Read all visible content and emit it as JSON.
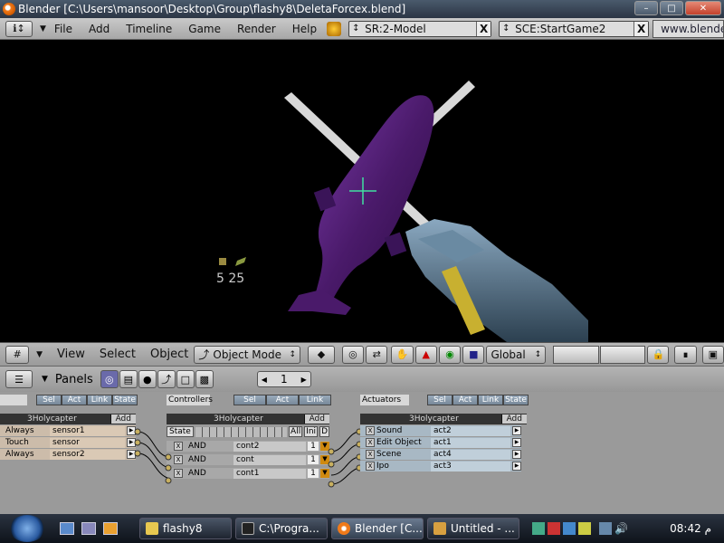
{
  "window": {
    "title": "Blender [C:\\Users\\mansoor\\Desktop\\Group\\flashy8\\DeletaForcex.blend]"
  },
  "menubar": {
    "items": [
      "File",
      "Add",
      "Timeline",
      "Game",
      "Render",
      "Help"
    ],
    "screen_field": "SR:2-Model",
    "scene_field": "SCE:StartGame2",
    "url": "www.blender.or"
  },
  "viewport": {
    "hud_numbers": "5 25",
    "colors": {
      "helicopter": "#4a1a6a",
      "blade": "#d8d8d8",
      "crosshair": "#40e0a0",
      "gun": "#5a7890"
    }
  },
  "header3d": {
    "view": "View",
    "select": "Select",
    "object": "Object",
    "mode": "Object Mode",
    "orientation": "Global"
  },
  "panels": {
    "label": "Panels",
    "page": "1",
    "sensors": {
      "tabs": [
        "Sel",
        "Act",
        "Link",
        "State"
      ],
      "object": "3Holycapter",
      "add": "Add",
      "rows": [
        {
          "type": "Always",
          "name": "sensor1"
        },
        {
          "type": "Touch",
          "name": "sensor"
        },
        {
          "type": "Always",
          "name": "sensor2"
        }
      ]
    },
    "controllers": {
      "title": "Controllers",
      "tabs": [
        "Sel",
        "Act",
        "Link"
      ],
      "object": "3Holycapter",
      "add": "Add",
      "state_label": "State",
      "all": "All",
      "ini": "Ini",
      "d": "D",
      "rows": [
        {
          "type": "AND",
          "name": "cont2",
          "num": "1"
        },
        {
          "type": "AND",
          "name": "cont",
          "num": "1"
        },
        {
          "type": "AND",
          "name": "cont1",
          "num": "1"
        }
      ]
    },
    "actuators": {
      "title": "Actuators",
      "tabs": [
        "Sel",
        "Act",
        "Link",
        "State"
      ],
      "object": "3Holycapter",
      "add": "Add",
      "rows": [
        {
          "type": "Sound",
          "name": "act2"
        },
        {
          "type": "Edit Object",
          "name": "act1"
        },
        {
          "type": "Scene",
          "name": "act4"
        },
        {
          "type": "Ipo",
          "name": "act3"
        }
      ]
    }
  },
  "taskbar": {
    "tasks": [
      "flashy8",
      "C:\\Progra...",
      "Blender [C...",
      "Untitled - ..."
    ],
    "clock": "08:42 م"
  }
}
